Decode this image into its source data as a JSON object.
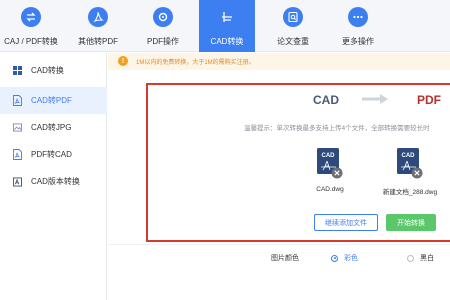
{
  "toolbar": {
    "items": [
      {
        "label": "CAJ / PDF转换",
        "icon": "swap-icon"
      },
      {
        "label": "其他转PDF",
        "icon": "pdf-icon"
      },
      {
        "label": "PDF操作",
        "icon": "gear-icon"
      },
      {
        "label": "CAD转换",
        "icon": "cad-icon",
        "active": true
      },
      {
        "label": "论文查重",
        "icon": "search-doc-icon"
      },
      {
        "label": "更多操作",
        "icon": "more-icon"
      }
    ]
  },
  "sidebar": {
    "items": [
      {
        "label": "CAD转换",
        "icon": "grid-icon"
      },
      {
        "label": "CAD转PDF",
        "icon": "pdf-file-icon",
        "active": true
      },
      {
        "label": "CAD转JPG",
        "icon": "image-file-icon"
      },
      {
        "label": "PDF转CAD",
        "icon": "pdf-file-icon"
      },
      {
        "label": "CAD版本转换",
        "icon": "cad-version-icon"
      }
    ]
  },
  "notice": {
    "text": "1M以内的免费转换，大于1M的需购买注册。"
  },
  "panel": {
    "from_format": "CAD",
    "to_format": "PDF",
    "tip": "温馨提示：单次转换最多支持上传4个文件，全部转换需要较长时",
    "files": [
      {
        "name": "CAD.dwg",
        "icon_text": "CAD"
      },
      {
        "name": "新建文档_288.dwg",
        "icon_text": "CAD"
      }
    ],
    "add_button": "继续添加文件",
    "start_button": "开始转换"
  },
  "options": {
    "label": "图片颜色",
    "color_option": "彩色",
    "bw_option": "黑白",
    "selected": "彩色"
  },
  "colors": {
    "accent": "#3d7ff0",
    "highlight_border": "#d63b2f",
    "start_green": "#5bc66a",
    "notice_bg": "#fdf5e6"
  }
}
